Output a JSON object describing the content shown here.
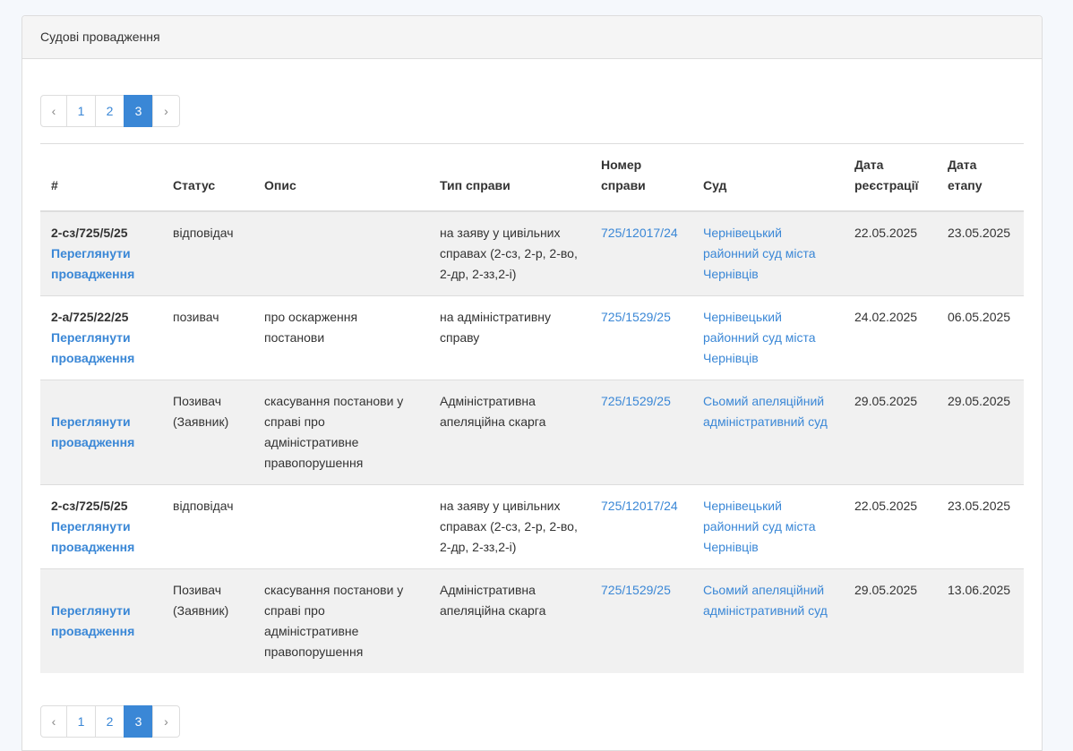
{
  "panel": {
    "title": "Судові провадження"
  },
  "pagination": {
    "prev": "‹",
    "next": "›",
    "pages": [
      "1",
      "2",
      "3"
    ],
    "current": "3"
  },
  "table": {
    "headers": {
      "num": "#",
      "status": "Статус",
      "desc": "Опис",
      "type": "Тип справи",
      "case_number": "Номер справи",
      "court": "Суд",
      "reg_date": "Дата реєстрації",
      "stage_date": "Дата етапу"
    },
    "view_label": "Переглянути провадження",
    "rows": [
      {
        "num": "2-сз/725/5/25",
        "status": "відповідач",
        "desc": "",
        "type": "на заяву у цивільних справах (2-сз, 2-р, 2-во, 2-др, 2-зз,2-і)",
        "case_number": "725/12017/24",
        "court": "Чернівецький районний суд міста Чернівців",
        "reg_date": "22.05.2025",
        "stage_date": "23.05.2025"
      },
      {
        "num": "2-а/725/22/25",
        "status": "позивач",
        "desc": "про оскарження постанови",
        "type": "на адміністративну справу",
        "case_number": "725/1529/25",
        "court": "Чернівецький районний суд міста Чернівців",
        "reg_date": "24.02.2025",
        "stage_date": "06.05.2025"
      },
      {
        "num": "",
        "status": "Позивач (Заявник)",
        "desc": "скасування постанови у справі про адміністративне правопорушення",
        "type": "Адміністративна апеляційна скарга",
        "case_number": "725/1529/25",
        "court": "Сьомий апеляційний адміністративний суд",
        "reg_date": "29.05.2025",
        "stage_date": "29.05.2025"
      },
      {
        "num": "2-сз/725/5/25",
        "status": "відповідач",
        "desc": "",
        "type": "на заяву у цивільних справах (2-сз, 2-р, 2-во, 2-др, 2-зз,2-і)",
        "case_number": "725/12017/24",
        "court": "Чернівецький районний суд міста Чернівців",
        "reg_date": "22.05.2025",
        "stage_date": "23.05.2025"
      },
      {
        "num": "",
        "status": "Позивач (Заявник)",
        "desc": "скасування постанови у справі про адміністративне правопорушення",
        "type": "Адміністративна апеляційна скарга",
        "case_number": "725/1529/25",
        "court": "Сьомий апеляційний адміністративний суд",
        "reg_date": "29.05.2025",
        "stage_date": "13.06.2025"
      }
    ]
  }
}
